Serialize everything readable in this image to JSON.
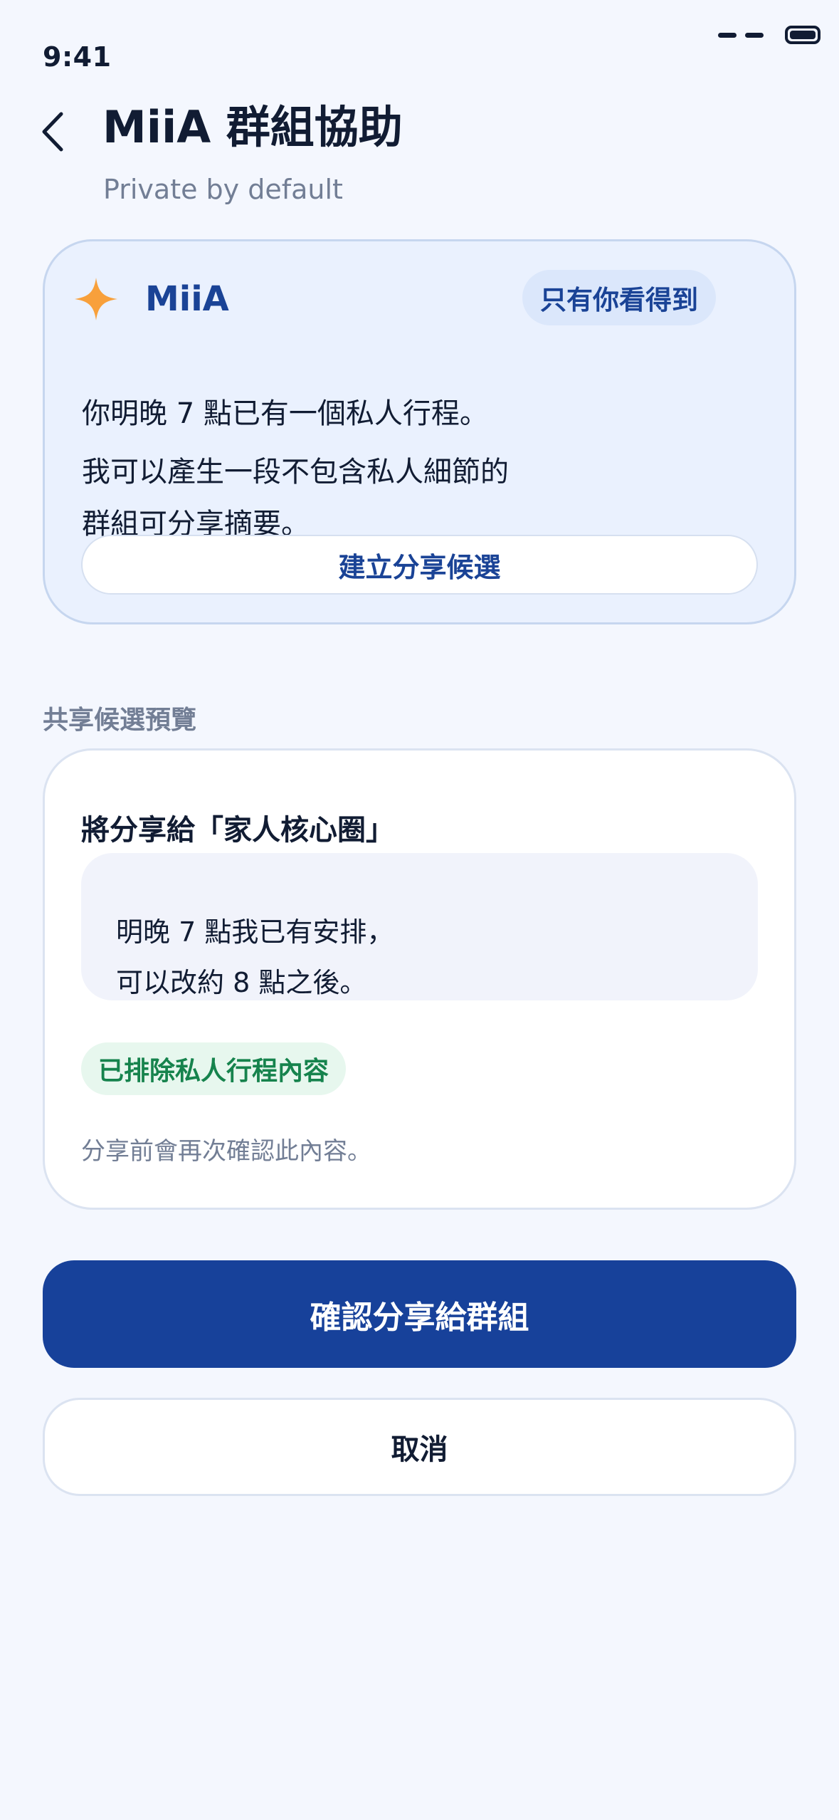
{
  "status_bar": {
    "time": "9:41",
    "icons": [
      "signal-dash-icon",
      "signal-dash-icon",
      "battery-icon"
    ]
  },
  "header": {
    "back_icon": "chevron-left-icon",
    "title": "MiiA 群組協助",
    "subtitle": "Private by default"
  },
  "assistant_card": {
    "icon": "sparkle-icon",
    "name": "MiiA",
    "privacy_badge": "只有你看得到",
    "message_lines": [
      "你明晚 7 點已有一個私人行程。",
      "我可以產生一段不包含私人細節的",
      "群組可分享摘要。"
    ],
    "create_button": "建立分享候選"
  },
  "preview": {
    "section_label": "共享候選預覽",
    "share_target": "將分享給「家人核心圈」",
    "message_lines": [
      "明晚 7 點我已有安排，",
      "可以改約 8 點之後。"
    ],
    "excluded_badge": "已排除私人行程內容",
    "confirm_note": "分享前會再次確認此內容。"
  },
  "actions": {
    "confirm_button": "確認分享給群組",
    "cancel_button": "取消"
  },
  "colors": {
    "background": "#f4f7fe",
    "primary": "#17419a",
    "accent_orange": "#f8a03b",
    "success_green": "#16834d",
    "muted_text": "#727e95"
  }
}
